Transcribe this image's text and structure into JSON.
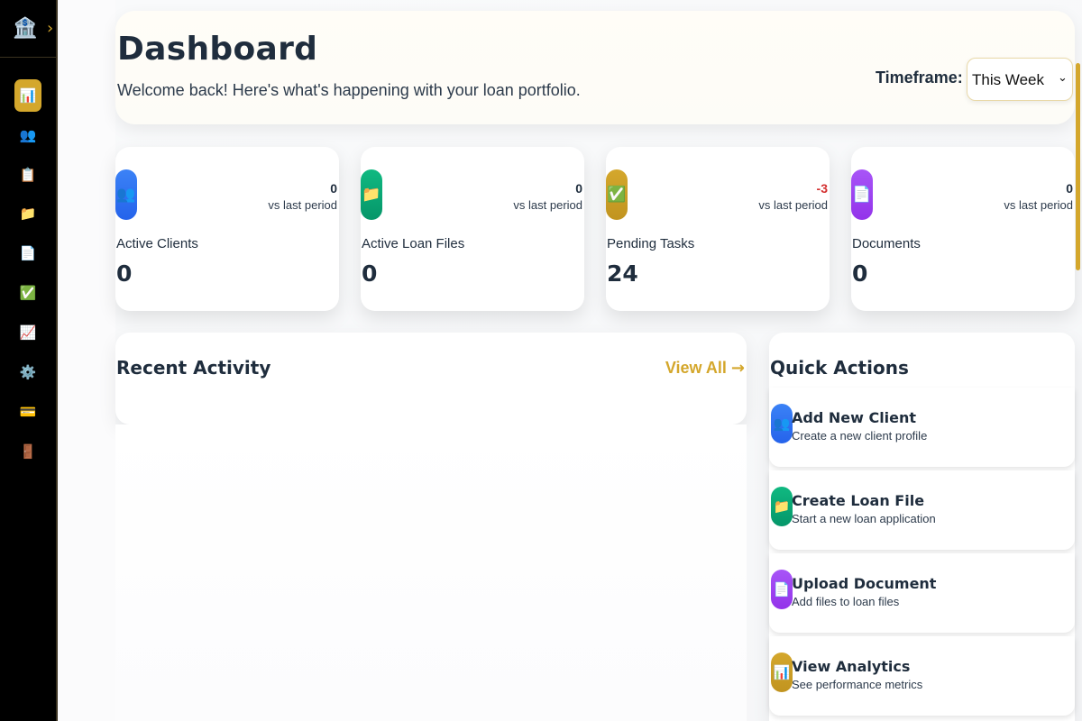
{
  "sidebar": {
    "brand_icon": "🏦",
    "expand_icon": "›",
    "items": [
      {
        "name": "dashboard",
        "icon": "📊"
      },
      {
        "name": "clients",
        "icon": "👥"
      },
      {
        "name": "tasks",
        "icon": "📋"
      },
      {
        "name": "loan-files",
        "icon": "📁"
      },
      {
        "name": "documents",
        "icon": "📄"
      },
      {
        "name": "approvals",
        "icon": "✅"
      },
      {
        "name": "analytics",
        "icon": "📈"
      },
      {
        "name": "settings",
        "icon": "⚙️"
      },
      {
        "name": "billing",
        "icon": "💳"
      },
      {
        "name": "logout",
        "icon": "🚪"
      }
    ]
  },
  "header": {
    "title": "Dashboard",
    "subtitle": "Welcome back! Here's what's happening with your loan portfolio.",
    "timeframe_label": "Timeframe:",
    "timeframe_value": "This Week",
    "timeframe_chevron": "⌄"
  },
  "stats": [
    {
      "label": "Active Clients",
      "value": "0",
      "change": "0",
      "change_note": "vs last period",
      "icon": "👥",
      "color": "#3b82f6"
    },
    {
      "label": "Active Loan Files",
      "value": "0",
      "change": "0",
      "change_note": "vs last period",
      "icon": "📁",
      "color": "#10b981"
    },
    {
      "label": "Pending Tasks",
      "value": "24",
      "change": "-3",
      "change_note": "vs last period",
      "icon": "✅",
      "color": "#d4a72c"
    },
    {
      "label": "Documents",
      "value": "0",
      "change": "0",
      "change_note": "vs last period",
      "icon": "📄",
      "color": "#a855f7"
    }
  ],
  "recent_activity": {
    "title": "Recent Activity",
    "view_all": "View All",
    "view_all_arrow": "→"
  },
  "quick_actions": {
    "title": "Quick Actions",
    "items": [
      {
        "title": "Add New Client",
        "desc": "Create a new client profile",
        "icon": "👥"
      },
      {
        "title": "Create Loan File",
        "desc": "Start a new loan application",
        "icon": "📁"
      },
      {
        "title": "Upload Document",
        "desc": "Add files to loan files",
        "icon": "📄"
      },
      {
        "title": "View Analytics",
        "desc": "See performance metrics",
        "icon": "📊"
      }
    ]
  },
  "colors": {
    "accent": "#d4a72c",
    "negative": "#d32f2f",
    "text": "#1f2d3d"
  }
}
